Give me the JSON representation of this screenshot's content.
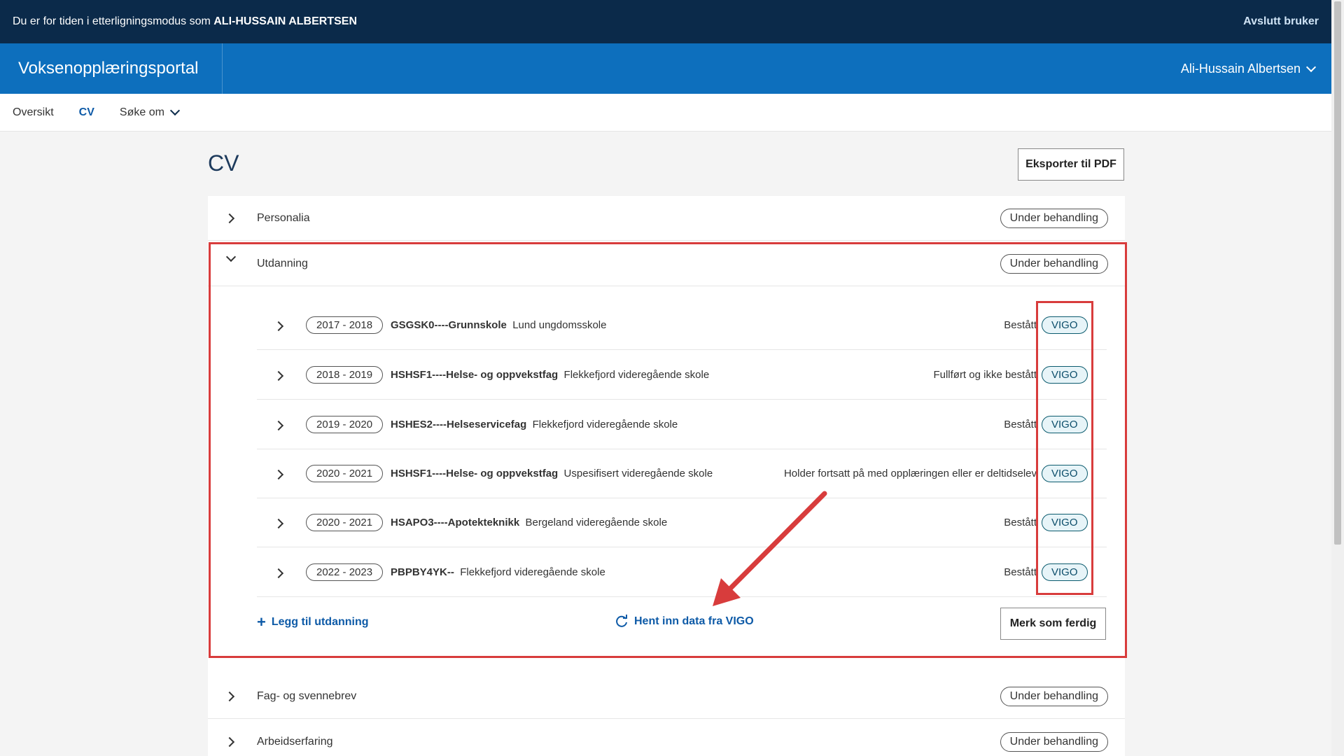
{
  "impersonation": {
    "prefix": "Du er for tiden i etterligningsmodus som",
    "name": "ALI-HUSSAIN ALBERTSEN",
    "end_label": "Avslutt bruker"
  },
  "portal": {
    "title": "Voksenopplæringsportal",
    "user_name": "Ali-Hussain Albertsen"
  },
  "nav": {
    "items": [
      {
        "label": "Oversikt"
      },
      {
        "label": "CV"
      },
      {
        "label": "Søke om"
      }
    ]
  },
  "page": {
    "title": "CV",
    "export_label": "Eksporter til PDF"
  },
  "sections": [
    {
      "label": "Personalia",
      "status": "Under behandling"
    },
    {
      "label": "Utdanning",
      "status": "Under behandling"
    },
    {
      "label": "Fag- og svennebrev",
      "status": "Under behandling"
    },
    {
      "label": "Arbeidserfaring",
      "status": "Under behandling"
    }
  ],
  "education": [
    {
      "years": "2017 - 2018",
      "code": "GSGSK0----Grunnskole",
      "school": "Lund ungdomsskole",
      "result": "Bestått",
      "source": "VIGO"
    },
    {
      "years": "2018 - 2019",
      "code": "HSHSF1----Helse- og oppvekstfag",
      "school": "Flekkefjord videregående skole",
      "result": "Fullført og ikke bestått",
      "source": "VIGO"
    },
    {
      "years": "2019 - 2020",
      "code": "HSHES2----Helseservicefag",
      "school": "Flekkefjord videregående skole",
      "result": "Bestått",
      "source": "VIGO"
    },
    {
      "years": "2020 - 2021",
      "code": "HSHSF1----Helse- og oppvekstfag",
      "school": "Uspesifisert videregående skole",
      "result": "Holder fortsatt på med opplæringen eller er deltidselev",
      "source": "VIGO"
    },
    {
      "years": "2020 - 2021",
      "code": "HSAPO3----Apotekteknikk",
      "school": "Bergeland videregående skole",
      "result": "Bestått",
      "source": "VIGO"
    },
    {
      "years": "2022 - 2023",
      "code": "PBPBY4YK--",
      "school": "Flekkefjord videregående skole",
      "result": "Bestått",
      "source": "VIGO"
    }
  ],
  "actions": {
    "add_education": "Legg til utdanning",
    "fetch_vigo": "Hent inn data fra VIGO",
    "mark_done": "Merk som ferdig"
  }
}
